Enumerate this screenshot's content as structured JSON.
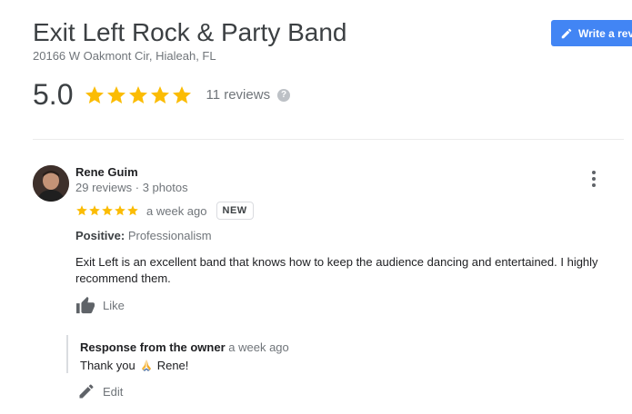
{
  "place": {
    "name": "Exit Left Rock & Party Band",
    "address": "20166 W Oakmont Cir, Hialeah, FL"
  },
  "write_review_button": {
    "label": "Write a review",
    "icon": "pencil-icon"
  },
  "summary": {
    "rating": "5.0",
    "stars": 5,
    "review_count": "11 reviews",
    "help_icon": "?"
  },
  "colors": {
    "accent": "#4285f4",
    "star": "#fbbc04",
    "muted": "#70757a"
  },
  "review": {
    "reviewer_name": "Rene Guim",
    "reviewer_meta": "29 reviews · 3 photos",
    "stars": 5,
    "time_ago": "a week ago",
    "badge": "NEW",
    "positive_label": "Positive:",
    "positive_value": "Professionalism",
    "text": "Exit Left is an excellent band that knows how to keep the audience dancing and entertained.  I highly recommend them.",
    "like_label": "Like"
  },
  "owner_response": {
    "title": "Response from the owner",
    "time_ago": "a week ago",
    "text_before": "Thank you",
    "text_after": "Rene!",
    "edit_label": "Edit"
  }
}
